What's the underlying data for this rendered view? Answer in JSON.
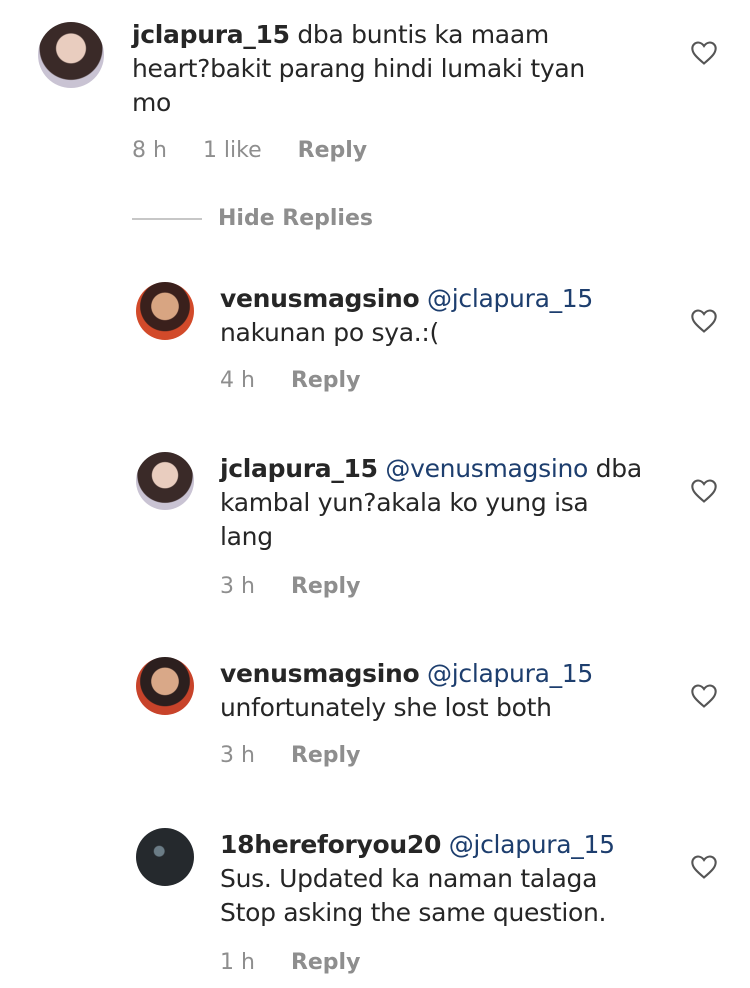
{
  "hide_replies_label": "Hide Replies",
  "comments": [
    {
      "username": "jclapura_15",
      "mention": "",
      "line1": " dba buntis ka maam",
      "line2": "heart?bakit parang hindi lumaki tyan",
      "line3": "mo",
      "time": "8 h",
      "likes": "1 like",
      "reply": "Reply"
    },
    {
      "username": "venusmagsino",
      "mention": "@jclapura_15",
      "line1": "",
      "line2": "nakunan po sya.:(",
      "line3": "",
      "time": "4 h",
      "likes": "",
      "reply": "Reply"
    },
    {
      "username": "jclapura_15",
      "mention": "@venusmagsino",
      "line1": " dba",
      "line2": "kambal yun?akala ko yung isa",
      "line3": "lang",
      "time": "3 h",
      "likes": "",
      "reply": "Reply"
    },
    {
      "username": "venusmagsino",
      "mention": "@jclapura_15",
      "line1": "",
      "line2": "unfortunately she lost both",
      "line3": "",
      "time": "3 h",
      "likes": "",
      "reply": "Reply"
    },
    {
      "username": "18hereforyou20",
      "mention": "@jclapura_15",
      "line1": "",
      "line2": "Sus. Updated ka naman talaga",
      "line3": "Stop asking the same question.",
      "time": "1 h",
      "likes": "",
      "reply": "Reply"
    }
  ]
}
